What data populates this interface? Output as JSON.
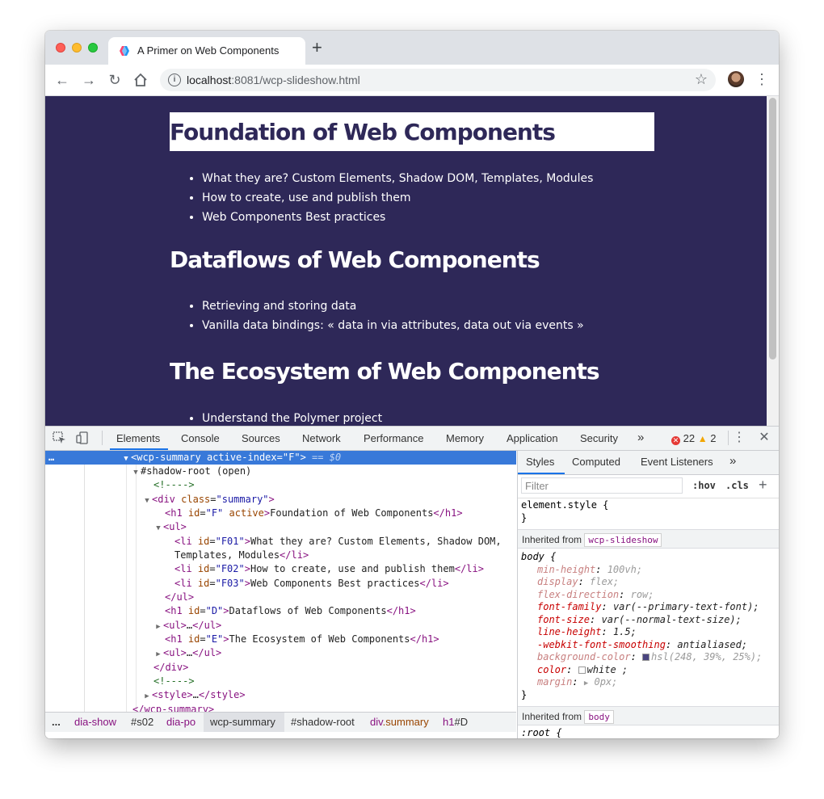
{
  "browser": {
    "tab_title": "A Primer on Web Components",
    "url_host": "localhost",
    "url_rest": ":8081/wcp-slideshow.html"
  },
  "slide": {
    "sections": [
      {
        "title": "Foundation of Web Components",
        "items": [
          "What they are? Custom Elements, Shadow DOM, Templates, Modules",
          "How to create, use and publish them",
          "Web Components Best practices"
        ]
      },
      {
        "title": "Dataflows of Web Components",
        "items": [
          "Retrieving and storing data",
          "Vanilla data bindings: « data in via attributes, data out via events »"
        ]
      },
      {
        "title": "The Ecosystem of Web Components",
        "items": [
          "Understand the Polymer project"
        ]
      }
    ]
  },
  "devtools": {
    "tabs": [
      "Elements",
      "Console",
      "Sources",
      "Network",
      "Performance",
      "Memory",
      "Application",
      "Security"
    ],
    "more": "»",
    "error_count": "22",
    "warning_count": "2",
    "dom": {
      "l0_tag": "<wcp-summary",
      "l0_attr": "active-index",
      "l0_val": "\"F\"",
      "l0_close": ">",
      "l0_eq": "== $0",
      "l1": "#shadow-root (open)",
      "l2": "<!---->",
      "l3_tag": "<div",
      "l3_attr": "class",
      "l3_val": "\"summary\"",
      "l4_id": "\"F\"",
      "l4_active": "active",
      "l4_text": "Foundation of Web Components",
      "l6_id": "\"F01\"",
      "l6_text": "What they are? Custom Elements, Shadow DOM,",
      "l6_text2": "Templates, Modules",
      "l7_id": "\"F02\"",
      "l7_text": "How to create, use and publish them",
      "l8_id": "\"F03\"",
      "l8_text": "Web Components Best practices",
      "l10_id": "\"D\"",
      "l10_text": "Dataflows of Web Components",
      "l11": "…",
      "l12_id": "\"E\"",
      "l12_text": "The Ecosystem of Web Components",
      "l16": "<!---->",
      "l17": "…",
      "l18": "</wcp-summary>"
    },
    "breadcrumbs": [
      "...",
      "dia-show",
      "#s02",
      "dia-po",
      "wcp-summary",
      "#shadow-root",
      "div",
      ".summary",
      "h1",
      "#D"
    ],
    "styles": {
      "tabs": [
        "Styles",
        "Computed",
        "Event Listeners"
      ],
      "more": "»",
      "filter_placeholder": "Filter",
      "hov": ":hov",
      "cls": ".cls",
      "plus": "+",
      "element_style": "element.style {",
      "close_brace": "}",
      "inherited_label": "Inherited from",
      "inherited_from_1": "wcp-slideshow",
      "inherited_from_2": "body",
      "body_selector": "body {",
      "root_selector": ":root {",
      "props": [
        {
          "name": "min-height",
          "value": "100vh;",
          "dim": true
        },
        {
          "name": "display",
          "value": "flex;",
          "dim": true
        },
        {
          "name": "flex-direction",
          "value": "row;",
          "dim": true
        },
        {
          "name": "font-family",
          "value": "var(--primary-text-font);",
          "dim": false
        },
        {
          "name": "font-size",
          "value": "var(--normal-text-size);",
          "dim": false
        },
        {
          "name": "line-height",
          "value": "1.5;",
          "dim": false
        },
        {
          "name": "-webkit-font-smoothing",
          "value": "antialiased;",
          "dim": false
        },
        {
          "name": "background-color",
          "value": "hsl(248, 39%, 25%);",
          "dim": true
        },
        {
          "name": "color",
          "value": "white ;",
          "dim": false
        },
        {
          "name": "margin",
          "value": "0px;",
          "dim": true
        }
      ]
    }
  },
  "colors": {
    "slide_background": "#2e2858",
    "selection": "#3879d9",
    "bgcolor_swatch": "#4a4580",
    "color_swatch": "#ffffff"
  }
}
